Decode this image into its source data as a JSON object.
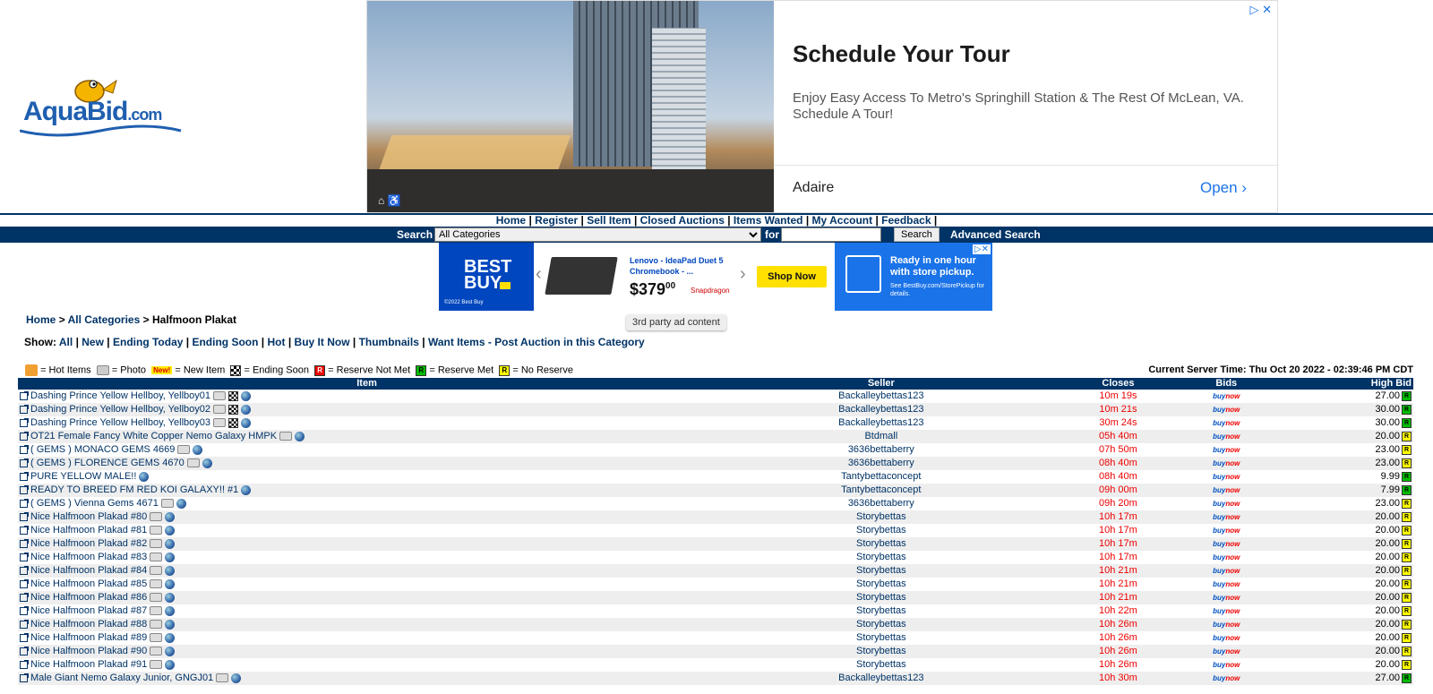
{
  "logo": {
    "text_main": "AquaBid",
    "text_suffix": ".com"
  },
  "top_ad": {
    "title": "Schedule Your Tour",
    "body": "Enjoy Easy Access To Metro's Springhill Station & The Rest Of McLean, VA. Schedule A Tour!",
    "brand": "Adaire",
    "cta": "Open",
    "choices": "▷ ✕"
  },
  "nav": {
    "items": [
      "Home",
      "Register",
      "Sell Item",
      "Closed Auctions",
      "Items Wanted",
      "My Account",
      "Feedback"
    ],
    "separator": "|"
  },
  "search": {
    "label": "Search",
    "category": "All Categories",
    "for_label": "for",
    "query": "",
    "button": "Search",
    "advanced": "Advanced Search"
  },
  "bestbuy_ad": {
    "logo": "BEST BUY",
    "copyright": "©2022 Best Buy",
    "product": "Lenovo - IdeaPad Duet 5 Chromebook - ...",
    "price": "$379",
    "price_cents": "00",
    "chip": "Snapdragon",
    "cta": "Shop Now",
    "pickup_headline": "Ready in one hour with store pickup.",
    "pickup_sub": "See BestBuy.com/StorePickup for details."
  },
  "third_party_label": "3rd party ad content",
  "breadcrumb": {
    "home": "Home",
    "all": "All Categories",
    "current": "Halfmoon Plakat",
    "sep": ">"
  },
  "show": {
    "label": "Show:",
    "links": [
      "All",
      "New",
      "Ending Today",
      "Ending Soon",
      "Hot",
      "Buy It Now",
      "Thumbnails",
      "Want Items - Post Auction in this Category"
    ]
  },
  "legend": {
    "hot": "= Hot Items",
    "photo": "= Photo",
    "new_badge": "New!",
    "new": "= New Item",
    "ending": "= Ending Soon",
    "rnm": "= Reserve Not Met",
    "rm": "= Reserve Met",
    "nr": "= No Reserve"
  },
  "server_time": "Current Server Time: Thu Oct 20 2022 - 02:39:46 PM CDT",
  "table": {
    "headers": {
      "item": "Item",
      "seller": "Seller",
      "closes": "Closes",
      "bids": "Bids",
      "high": "High Bid"
    },
    "buynow_buy": "buy",
    "buynow_now": "now",
    "rows": [
      {
        "item": "Dashing Prince Yellow Hellboy, Yellboy01",
        "photo": true,
        "ending": true,
        "seller": "Backalleybettas123",
        "closes": "10m 19s",
        "high": "27.00",
        "res": "R",
        "rescolor": "#0b0"
      },
      {
        "item": "Dashing Prince Yellow Hellboy, Yellboy02",
        "photo": true,
        "ending": true,
        "seller": "Backalleybettas123",
        "closes": "10m 21s",
        "high": "30.00",
        "res": "R",
        "rescolor": "#0b0"
      },
      {
        "item": "Dashing Prince Yellow Hellboy, Yellboy03",
        "photo": true,
        "ending": true,
        "seller": "Backalleybettas123",
        "closes": "30m 24s",
        "high": "30.00",
        "res": "R",
        "rescolor": "#0b0"
      },
      {
        "item": "OT21 Female Fancy White Copper Nemo Galaxy HMPK",
        "photo": true,
        "ending": false,
        "seller": "Btdmall",
        "closes": "05h 40m",
        "high": "20.00",
        "res": "R",
        "rescolor": "#ff0"
      },
      {
        "item": "( GEMS ) MONACO GEMS 4669",
        "photo": true,
        "ending": false,
        "seller": "3636bettaberry",
        "closes": "07h 50m",
        "high": "23.00",
        "res": "R",
        "rescolor": "#ff0"
      },
      {
        "item": "( GEMS ) FLORENCE GEMS 4670",
        "photo": true,
        "ending": false,
        "seller": "3636bettaberry",
        "closes": "08h 40m",
        "high": "23.00",
        "res": "R",
        "rescolor": "#ff0"
      },
      {
        "item": "PURE YELLOW MALE!!",
        "photo": false,
        "ending": false,
        "seller": "Tantybettaconcept",
        "closes": "08h 40m",
        "high": "9.99",
        "res": "R",
        "rescolor": "#0b0"
      },
      {
        "item": "READY TO BREED FM RED KOI GALAXY!! #1",
        "photo": false,
        "ending": false,
        "seller": "Tantybettaconcept",
        "closes": "09h 00m",
        "high": "7.99",
        "res": "R",
        "rescolor": "#0b0"
      },
      {
        "item": "( GEMS ) Vienna Gems 4671",
        "photo": true,
        "ending": false,
        "seller": "3636bettaberry",
        "closes": "09h 20m",
        "high": "23.00",
        "res": "R",
        "rescolor": "#ff0"
      },
      {
        "item": "Nice Halfmoon Plakad #80",
        "photo": true,
        "ending": false,
        "seller": "Storybettas",
        "closes": "10h 17m",
        "high": "20.00",
        "res": "R",
        "rescolor": "#ff0"
      },
      {
        "item": "Nice Halfmoon Plakad #81",
        "photo": true,
        "ending": false,
        "seller": "Storybettas",
        "closes": "10h 17m",
        "high": "20.00",
        "res": "R",
        "rescolor": "#ff0"
      },
      {
        "item": "Nice Halfmoon Plakad #82",
        "photo": true,
        "ending": false,
        "seller": "Storybettas",
        "closes": "10h 17m",
        "high": "20.00",
        "res": "R",
        "rescolor": "#ff0"
      },
      {
        "item": "Nice Halfmoon Plakad #83",
        "photo": true,
        "ending": false,
        "seller": "Storybettas",
        "closes": "10h 17m",
        "high": "20.00",
        "res": "R",
        "rescolor": "#ff0"
      },
      {
        "item": "Nice Halfmoon Plakad #84",
        "photo": true,
        "ending": false,
        "seller": "Storybettas",
        "closes": "10h 21m",
        "high": "20.00",
        "res": "R",
        "rescolor": "#ff0"
      },
      {
        "item": "Nice Halfmoon Plakad #85",
        "photo": true,
        "ending": false,
        "seller": "Storybettas",
        "closes": "10h 21m",
        "high": "20.00",
        "res": "R",
        "rescolor": "#ff0"
      },
      {
        "item": "Nice Halfmoon Plakad #86",
        "photo": true,
        "ending": false,
        "seller": "Storybettas",
        "closes": "10h 21m",
        "high": "20.00",
        "res": "R",
        "rescolor": "#ff0"
      },
      {
        "item": "Nice Halfmoon Plakad #87",
        "photo": true,
        "ending": false,
        "seller": "Storybettas",
        "closes": "10h 22m",
        "high": "20.00",
        "res": "R",
        "rescolor": "#ff0"
      },
      {
        "item": "Nice Halfmoon Plakad #88",
        "photo": true,
        "ending": false,
        "seller": "Storybettas",
        "closes": "10h 26m",
        "high": "20.00",
        "res": "R",
        "rescolor": "#ff0"
      },
      {
        "item": "Nice Halfmoon Plakad #89",
        "photo": true,
        "ending": false,
        "seller": "Storybettas",
        "closes": "10h 26m",
        "high": "20.00",
        "res": "R",
        "rescolor": "#ff0"
      },
      {
        "item": "Nice Halfmoon Plakad #90",
        "photo": true,
        "ending": false,
        "seller": "Storybettas",
        "closes": "10h 26m",
        "high": "20.00",
        "res": "R",
        "rescolor": "#ff0"
      },
      {
        "item": "Nice Halfmoon Plakad #91",
        "photo": true,
        "ending": false,
        "seller": "Storybettas",
        "closes": "10h 26m",
        "high": "20.00",
        "res": "R",
        "rescolor": "#ff0"
      },
      {
        "item": "Male Giant Nemo Galaxy Junior, GNGJ01",
        "photo": true,
        "ending": false,
        "seller": "Backalleybettas123",
        "closes": "10h 30m",
        "high": "27.00",
        "res": "R",
        "rescolor": "#0b0"
      }
    ]
  }
}
